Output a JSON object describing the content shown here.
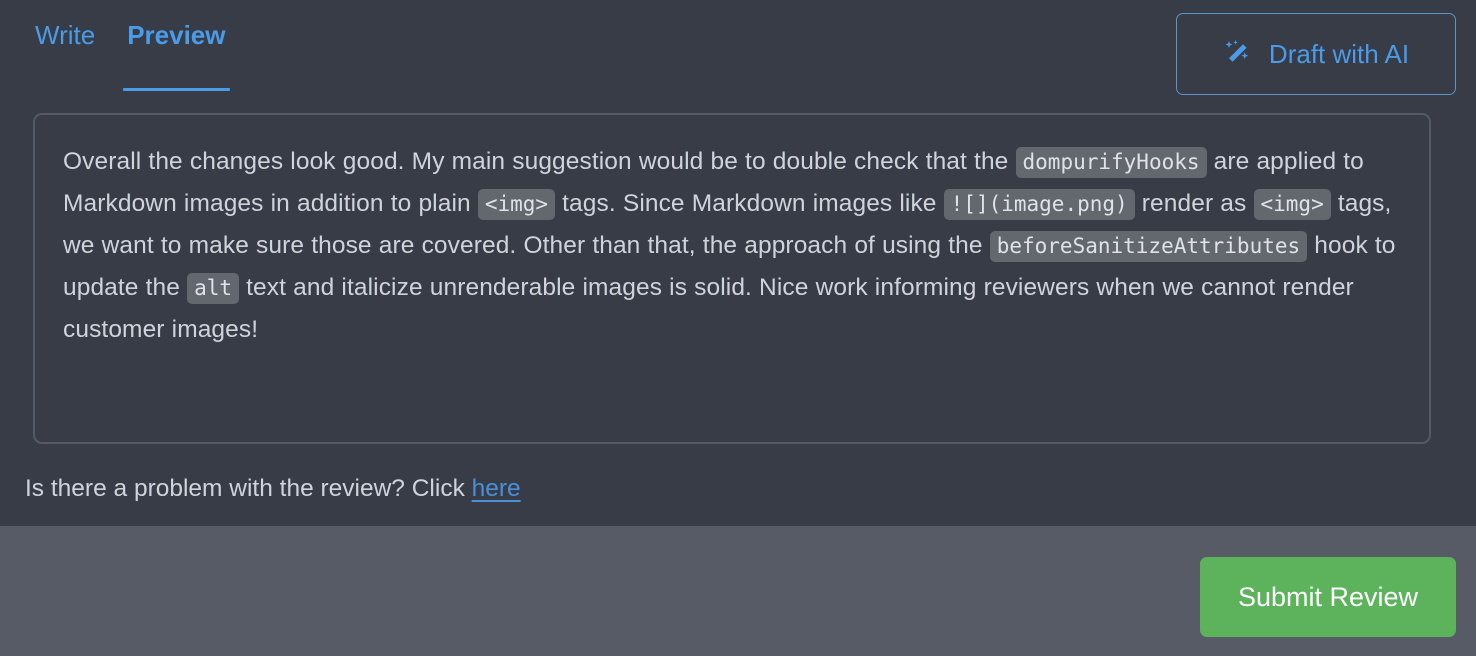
{
  "tabs": [
    {
      "id": "write",
      "label": "Write",
      "active": false
    },
    {
      "id": "preview",
      "label": "Preview",
      "active": true
    }
  ],
  "draft_ai": {
    "label": "Draft with AI",
    "icon": "magic-wand-icon",
    "accent_color": "#4a9be8",
    "border_color": "#5c93c9"
  },
  "preview": {
    "segments": [
      {
        "type": "text",
        "value": "Overall the changes look good. My main suggestion would be to double check that the "
      },
      {
        "type": "code",
        "value": "dompurifyHooks"
      },
      {
        "type": "text",
        "value": " are applied to Markdown images in addition to plain "
      },
      {
        "type": "code",
        "value": "<img>"
      },
      {
        "type": "text",
        "value": " tags. Since Markdown images like "
      },
      {
        "type": "code",
        "value": "![](image.png)"
      },
      {
        "type": "text",
        "value": " render as "
      },
      {
        "type": "code",
        "value": "<img>"
      },
      {
        "type": "text",
        "value": " tags, we want to make sure those are covered. Other than that, the approach of using the "
      },
      {
        "type": "code",
        "value": "beforeSanitizeAttributes"
      },
      {
        "type": "text",
        "value": " hook to update the "
      },
      {
        "type": "code",
        "value": "alt"
      },
      {
        "type": "text",
        "value": " text and italicize unrenderable images is solid. Nice work informing reviewers when we cannot render customer images!"
      }
    ],
    "plain_text": "Overall the changes look good. My main suggestion would be to double check that the dompurifyHooks are applied to Markdown images in addition to plain <img> tags. Since Markdown images like ![](image.png) render as <img> tags, we want to make sure those are covered. Other than that, the approach of using the beforeSanitizeAttributes hook to update the alt text and italicize unrenderable images is solid. Nice work informing reviewers when we cannot render customer images!",
    "border_color": "#545a66",
    "code_background": "#63686f"
  },
  "problem_prompt": {
    "text_before": "Is there a problem with the review? Click ",
    "link_label": "here",
    "link_color": "#4a90d9"
  },
  "footer": {
    "submit_label": "Submit Review",
    "submit_color": "#5cb35c",
    "background": "#565b65"
  },
  "theme": {
    "page_background": "#373c46",
    "body_text": "#cfd4dc",
    "accent_blue": "#4a9be8"
  }
}
